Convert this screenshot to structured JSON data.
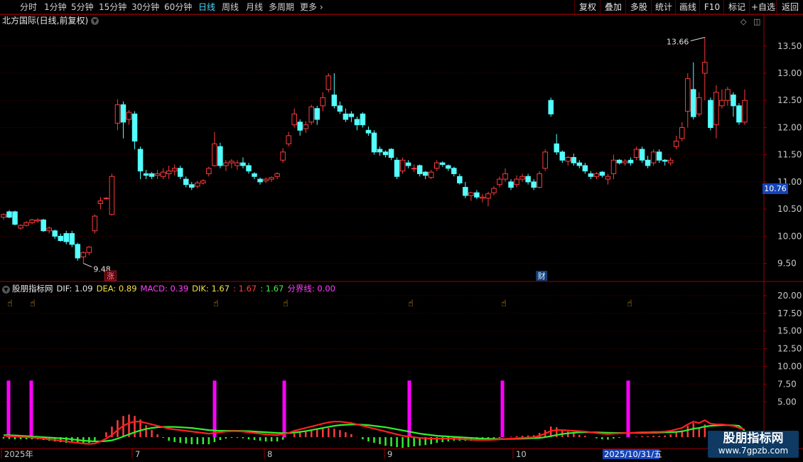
{
  "toolbar": {
    "periods": [
      "分时",
      "1分钟",
      "5分钟",
      "15分钟",
      "30分钟",
      "60分钟",
      "日线",
      "周线",
      "月线",
      "多周期",
      "更多"
    ],
    "active_period": "日线",
    "right_buttons": [
      "复权",
      "叠加",
      "多股",
      "统计",
      "画线",
      "F10",
      "标记",
      "+自选",
      "返回"
    ]
  },
  "stock": {
    "title": "北方国际(日线,前复权)"
  },
  "indicator": {
    "name": "股朋指标网",
    "values": [
      {
        "text": "DIF: 1.09",
        "color": "#e8e8e8"
      },
      {
        "text": "DEA: 0.89",
        "color": "#f2e34a"
      },
      {
        "text": "MACD: 0.39",
        "color": "#ff40ff"
      },
      {
        "text": "DIK: 1.67",
        "color": "#f2e34a"
      },
      {
        "text": ": 1.67",
        "color": "#ff3b3b"
      },
      {
        "text": ": 1.67",
        "color": "#3cf23c"
      },
      {
        "text": "分界线: 0.00",
        "color": "#ff40ff"
      }
    ]
  },
  "current_price": "10.76",
  "markers": {
    "high": "13.66",
    "low": "9.48",
    "zhang": "涨",
    "cai": "财"
  },
  "watermark": {
    "line1": "股朋指标网",
    "line2": "www.7gpzb.com"
  },
  "colors": {
    "up": "#ff3b3b",
    "down": "#54ffff",
    "grid": "#5a0000",
    "axis": "#a00000",
    "signal": "#ff00ff",
    "dif": "#ff2020",
    "dea": "#30f030"
  },
  "chart_data": {
    "type": "candlestick",
    "price_axis": {
      "ticks": [
        9.5,
        10.0,
        10.5,
        11.0,
        11.5,
        12.0,
        12.5,
        13.0,
        13.5
      ],
      "ylim": [
        9.22,
        13.85
      ]
    },
    "indicator_axis": {
      "ticks": [
        5.0,
        7.5,
        10.0,
        12.5,
        15.0,
        17.5,
        20.0
      ],
      "ylim": [
        -1.5,
        21.2
      ]
    },
    "x_labels": [
      "2025年",
      "7",
      "8",
      "9",
      "10",
      "2025/10/31/五"
    ],
    "candles": [
      [
        10.35,
        10.4,
        10.3,
        10.42
      ],
      [
        10.45,
        10.35,
        10.33,
        10.48
      ],
      [
        10.45,
        10.22,
        10.2,
        10.47
      ],
      [
        10.15,
        10.2,
        10.12,
        10.22
      ],
      [
        10.2,
        10.25,
        10.18,
        10.28
      ],
      [
        10.25,
        10.3,
        10.22,
        10.32
      ],
      [
        10.28,
        10.3,
        10.25,
        10.33
      ],
      [
        10.3,
        10.1,
        10.08,
        10.32
      ],
      [
        10.1,
        10.15,
        10.05,
        10.18
      ],
      [
        10.1,
        10.0,
        9.95,
        10.12
      ],
      [
        10.0,
        9.92,
        9.9,
        10.05
      ],
      [
        10.05,
        9.9,
        9.85,
        10.1
      ],
      [
        10.05,
        9.85,
        9.8,
        10.1
      ],
      [
        9.85,
        9.6,
        9.55,
        9.88
      ],
      [
        9.62,
        9.7,
        9.5,
        9.72
      ],
      [
        9.7,
        9.8,
        9.65,
        9.82
      ],
      [
        10.1,
        10.37,
        10.05,
        10.4
      ],
      [
        10.6,
        10.65,
        10.5,
        10.72
      ],
      [
        10.7,
        10.7,
        10.68,
        10.72
      ],
      [
        10.4,
        11.1,
        10.38,
        11.15
      ],
      [
        12.08,
        12.42,
        11.95,
        12.52
      ],
      [
        12.42,
        12.1,
        11.8,
        12.48
      ],
      [
        12.15,
        12.28,
        12.05,
        12.32
      ],
      [
        12.25,
        11.75,
        11.6,
        12.3
      ],
      [
        11.6,
        11.2,
        11.05,
        11.65
      ],
      [
        11.15,
        11.12,
        11.05,
        11.22
      ],
      [
        11.15,
        11.1,
        11.05,
        11.18
      ],
      [
        11.12,
        11.15,
        11.05,
        11.22
      ],
      [
        11.1,
        11.18,
        11.05,
        11.25
      ],
      [
        11.15,
        11.2,
        11.05,
        11.3
      ],
      [
        11.2,
        11.25,
        11.12,
        11.32
      ],
      [
        11.25,
        11.1,
        11.05,
        11.3
      ],
      [
        11.05,
        10.95,
        10.9,
        11.1
      ],
      [
        10.95,
        10.9,
        10.85,
        11.0
      ],
      [
        10.92,
        10.98,
        10.88,
        11.02
      ],
      [
        10.98,
        11.02,
        10.95,
        11.05
      ],
      [
        11.15,
        11.25,
        11.1,
        11.28
      ],
      [
        11.3,
        11.7,
        11.28,
        11.92
      ],
      [
        11.65,
        11.3,
        11.25,
        11.72
      ],
      [
        11.3,
        11.35,
        11.2,
        11.4
      ],
      [
        11.35,
        11.38,
        11.25,
        11.42
      ],
      [
        11.3,
        11.35,
        11.22,
        11.4
      ],
      [
        11.35,
        11.3,
        11.25,
        11.45
      ],
      [
        11.3,
        11.2,
        11.15,
        11.35
      ],
      [
        11.15,
        11.1,
        11.05,
        11.18
      ],
      [
        11.05,
        11.0,
        10.95,
        11.08
      ],
      [
        11.02,
        11.05,
        10.98,
        11.08
      ],
      [
        11.05,
        11.08,
        11.0,
        11.1
      ],
      [
        11.1,
        11.15,
        11.05,
        11.18
      ],
      [
        11.4,
        11.55,
        11.35,
        11.62
      ],
      [
        11.7,
        11.85,
        11.65,
        11.92
      ],
      [
        12.05,
        12.25,
        12.0,
        12.35
      ],
      [
        12.1,
        11.95,
        11.85,
        12.15
      ],
      [
        11.98,
        12.05,
        11.9,
        12.12
      ],
      [
        12.1,
        12.38,
        12.05,
        12.42
      ],
      [
        12.35,
        12.15,
        12.05,
        12.4
      ],
      [
        12.4,
        12.55,
        12.3,
        12.65
      ],
      [
        12.7,
        12.95,
        12.65,
        13.0
      ],
      [
        12.6,
        12.4,
        12.35,
        13.0
      ],
      [
        12.4,
        12.3,
        12.25,
        12.48
      ],
      [
        12.25,
        12.15,
        12.1,
        12.35
      ],
      [
        12.25,
        12.2,
        12.1,
        12.3
      ],
      [
        12.15,
        12.05,
        11.95,
        12.2
      ],
      [
        12.25,
        12.05,
        12.0,
        12.28
      ],
      [
        11.95,
        11.9,
        11.85,
        12.02
      ],
      [
        11.9,
        11.55,
        11.5,
        11.95
      ],
      [
        11.6,
        11.55,
        11.48,
        11.65
      ],
      [
        11.55,
        11.5,
        11.45,
        11.58
      ],
      [
        11.6,
        11.45,
        11.4,
        11.62
      ],
      [
        11.4,
        11.1,
        11.05,
        11.45
      ],
      [
        11.2,
        11.4,
        11.15,
        11.45
      ],
      [
        11.35,
        11.3,
        11.25,
        11.4
      ],
      [
        11.25,
        11.25,
        11.18,
        11.32
      ],
      [
        11.3,
        11.15,
        11.1,
        11.32
      ],
      [
        11.18,
        11.12,
        11.05,
        11.2
      ],
      [
        11.08,
        11.18,
        11.05,
        11.22
      ],
      [
        11.25,
        11.35,
        11.2,
        11.4
      ],
      [
        11.35,
        11.32,
        11.28,
        11.38
      ],
      [
        11.3,
        11.25,
        11.2,
        11.32
      ],
      [
        11.25,
        11.15,
        11.1,
        11.28
      ],
      [
        11.1,
        10.98,
        10.95,
        11.15
      ],
      [
        10.9,
        10.75,
        10.7,
        11.0
      ],
      [
        10.75,
        10.8,
        10.65,
        10.82
      ],
      [
        10.8,
        10.72,
        10.68,
        10.85
      ],
      [
        10.7,
        10.72,
        10.62,
        10.78
      ],
      [
        10.7,
        10.78,
        10.55,
        10.82
      ],
      [
        10.8,
        10.88,
        10.75,
        10.92
      ],
      [
        10.95,
        11.05,
        10.9,
        11.1
      ],
      [
        11.05,
        11.15,
        11.0,
        11.25
      ],
      [
        11.0,
        10.9,
        10.85,
        11.05
      ],
      [
        10.95,
        11.05,
        10.9,
        11.12
      ],
      [
        11.05,
        11.1,
        11.0,
        11.15
      ],
      [
        11.1,
        11.0,
        10.95,
        11.15
      ],
      [
        11.0,
        10.9,
        10.85,
        11.05
      ],
      [
        10.9,
        11.15,
        10.88,
        11.2
      ],
      [
        11.25,
        11.55,
        11.2,
        11.6
      ],
      [
        12.5,
        12.25,
        12.2,
        12.55
      ],
      [
        11.7,
        11.55,
        11.5,
        11.88
      ],
      [
        11.55,
        11.4,
        11.35,
        11.58
      ],
      [
        11.38,
        11.45,
        11.3,
        11.48
      ],
      [
        11.45,
        11.35,
        11.3,
        11.52
      ],
      [
        11.35,
        11.3,
        11.25,
        11.4
      ],
      [
        11.3,
        11.2,
        11.15,
        11.35
      ],
      [
        11.15,
        11.1,
        11.05,
        11.2
      ],
      [
        11.1,
        11.15,
        11.05,
        11.18
      ],
      [
        11.18,
        11.12,
        11.08,
        11.2
      ],
      [
        11.05,
        11.1,
        10.95,
        11.15
      ],
      [
        11.15,
        11.4,
        11.05,
        11.5
      ],
      [
        11.4,
        11.35,
        11.32,
        11.42
      ],
      [
        11.35,
        11.38,
        11.3,
        11.42
      ],
      [
        11.4,
        11.35,
        11.3,
        11.45
      ],
      [
        11.45,
        11.6,
        11.4,
        11.65
      ],
      [
        11.6,
        11.4,
        11.35,
        11.65
      ],
      [
        11.4,
        11.3,
        11.25,
        11.48
      ],
      [
        11.35,
        11.55,
        11.3,
        11.6
      ],
      [
        11.55,
        11.4,
        11.35,
        11.6
      ],
      [
        11.4,
        11.38,
        11.3,
        11.42
      ],
      [
        11.35,
        11.4,
        11.3,
        11.45
      ],
      [
        11.65,
        11.75,
        11.6,
        11.85
      ],
      [
        11.8,
        12.0,
        11.75,
        12.1
      ],
      [
        12.3,
        12.9,
        12.0,
        13.0
      ],
      [
        12.7,
        12.2,
        12.15,
        13.2
      ],
      [
        12.25,
        12.55,
        12.2,
        12.65
      ],
      [
        13.0,
        13.2,
        12.5,
        13.66
      ],
      [
        12.5,
        12.0,
        11.95,
        12.55
      ],
      [
        12.05,
        12.65,
        11.8,
        12.78
      ],
      [
        12.4,
        12.5,
        12.35,
        12.7
      ],
      [
        12.5,
        12.7,
        12.4,
        12.75
      ],
      [
        12.6,
        12.4,
        12.2,
        12.65
      ],
      [
        12.4,
        12.1,
        12.05,
        12.45
      ],
      [
        12.1,
        12.5,
        12.05,
        12.7
      ]
    ],
    "dif": [
      0.2,
      0.15,
      0.1,
      0.05,
      0.0,
      -0.05,
      -0.1,
      -0.2,
      -0.3,
      -0.4,
      -0.5,
      -0.6,
      -0.7,
      -0.8,
      -0.9,
      -0.95,
      -0.9,
      -0.6,
      -0.2,
      0.3,
      1.0,
      1.6,
      2.0,
      2.2,
      2.2,
      2.0,
      1.8,
      1.6,
      1.4,
      1.2,
      1.1,
      1.0,
      0.9,
      0.8,
      0.7,
      0.6,
      0.5,
      0.6,
      0.7,
      0.8,
      0.85,
      0.85,
      0.8,
      0.7,
      0.6,
      0.5,
      0.4,
      0.35,
      0.3,
      0.4,
      0.6,
      0.9,
      1.1,
      1.3,
      1.5,
      1.7,
      1.9,
      2.1,
      2.2,
      2.2,
      2.1,
      2.0,
      1.8,
      1.6,
      1.4,
      1.2,
      1.0,
      0.8,
      0.6,
      0.4,
      0.2,
      0.1,
      0.0,
      -0.1,
      -0.15,
      -0.2,
      -0.2,
      -0.2,
      -0.2,
      -0.2,
      -0.25,
      -0.3,
      -0.35,
      -0.4,
      -0.4,
      -0.4,
      -0.35,
      -0.3,
      -0.25,
      -0.2,
      -0.15,
      -0.1,
      -0.05,
      0.0,
      0.2,
      0.5,
      0.9,
      1.0,
      1.0,
      0.95,
      0.9,
      0.85,
      0.8,
      0.7,
      0.6,
      0.5,
      0.45,
      0.5,
      0.55,
      0.6,
      0.6,
      0.65,
      0.7,
      0.7,
      0.75,
      0.75,
      0.8,
      0.9,
      1.1,
      1.3,
      1.8,
      2.2,
      2.0,
      2.4,
      1.9,
      1.8,
      1.8,
      1.7,
      1.6,
      1.3,
      1.09
    ],
    "dea": [
      0.3,
      0.28,
      0.25,
      0.2,
      0.15,
      0.1,
      0.05,
      0.0,
      -0.05,
      -0.1,
      -0.15,
      -0.2,
      -0.3,
      -0.4,
      -0.5,
      -0.55,
      -0.6,
      -0.6,
      -0.55,
      -0.45,
      -0.2,
      0.1,
      0.4,
      0.7,
      0.95,
      1.15,
      1.3,
      1.4,
      1.45,
      1.45,
      1.45,
      1.4,
      1.35,
      1.3,
      1.2,
      1.1,
      1.0,
      0.95,
      0.9,
      0.9,
      0.9,
      0.9,
      0.88,
      0.85,
      0.8,
      0.75,
      0.7,
      0.65,
      0.6,
      0.58,
      0.6,
      0.65,
      0.75,
      0.85,
      1.0,
      1.15,
      1.3,
      1.45,
      1.6,
      1.7,
      1.75,
      1.78,
      1.78,
      1.75,
      1.7,
      1.6,
      1.5,
      1.4,
      1.25,
      1.1,
      0.95,
      0.8,
      0.65,
      0.5,
      0.4,
      0.3,
      0.2,
      0.15,
      0.1,
      0.05,
      0.0,
      -0.05,
      -0.1,
      -0.15,
      -0.2,
      -0.22,
      -0.24,
      -0.25,
      -0.25,
      -0.24,
      -0.22,
      -0.2,
      -0.17,
      -0.14,
      -0.1,
      0.0,
      0.15,
      0.3,
      0.45,
      0.55,
      0.62,
      0.68,
      0.7,
      0.7,
      0.68,
      0.65,
      0.62,
      0.6,
      0.6,
      0.6,
      0.6,
      0.61,
      0.62,
      0.63,
      0.65,
      0.66,
      0.68,
      0.7,
      0.75,
      0.82,
      1.0,
      1.2,
      1.3,
      1.5,
      1.6,
      1.65,
      1.7,
      1.7,
      1.66,
      1.6,
      0.89
    ],
    "signals_x": [
      3,
      11,
      84,
      113,
      163,
      204,
      252
    ]
  }
}
